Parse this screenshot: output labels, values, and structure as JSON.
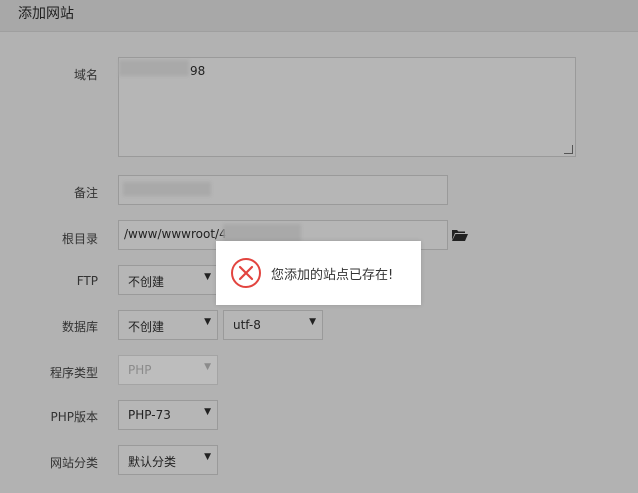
{
  "dialog": {
    "title": "添加网站"
  },
  "form": {
    "domain": {
      "label": "域名",
      "value_visible": "98"
    },
    "remark": {
      "label": "备注"
    },
    "root_dir": {
      "label": "根目录",
      "value_visible": "/www/wwwroot/4"
    },
    "ftp": {
      "label": "FTP",
      "selected": "不创建"
    },
    "database": {
      "label": "数据库",
      "selected": "不创建",
      "charset": "utf-8"
    },
    "program_type": {
      "label": "程序类型",
      "selected": "PHP"
    },
    "php_version": {
      "label": "PHP版本",
      "selected": "PHP-73"
    },
    "site_category": {
      "label": "网站分类",
      "selected": "默认分类"
    }
  },
  "toast": {
    "message": "您添加的站点已存在!",
    "icon": "error-circle-x-icon",
    "icon_color": "#e2443f"
  }
}
